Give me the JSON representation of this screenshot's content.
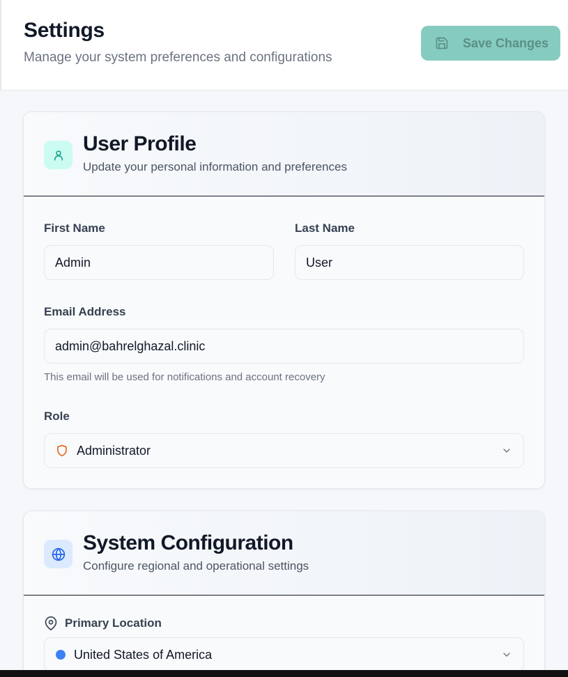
{
  "header": {
    "title": "Settings",
    "subtitle": "Manage your system preferences and configurations",
    "save_label": "Save Changes"
  },
  "colors": {
    "accent": "#86cbbf",
    "accent_icon_bg": "#ccfbf1",
    "blue_icon_bg": "#dbeafe",
    "role_shield": "#ea580c",
    "location_dot": "#3b82f6"
  },
  "user_profile": {
    "title": "User Profile",
    "subtitle": "Update your personal information and preferences",
    "icon": "user-icon",
    "first_name_label": "First Name",
    "first_name_value": "Admin",
    "last_name_label": "Last Name",
    "last_name_value": "User",
    "email_label": "Email Address",
    "email_value": "admin@bahrelghazal.clinic",
    "email_hint": "This email will be used for notifications and account recovery",
    "role_label": "Role",
    "role_value": "Administrator",
    "role_icon": "shield-icon"
  },
  "system_config": {
    "title": "System Configuration",
    "subtitle": "Configure regional and operational settings",
    "icon": "globe-icon",
    "location_label": "Primary Location",
    "location_icon": "map-pin-icon",
    "location_value": "United States of America"
  }
}
